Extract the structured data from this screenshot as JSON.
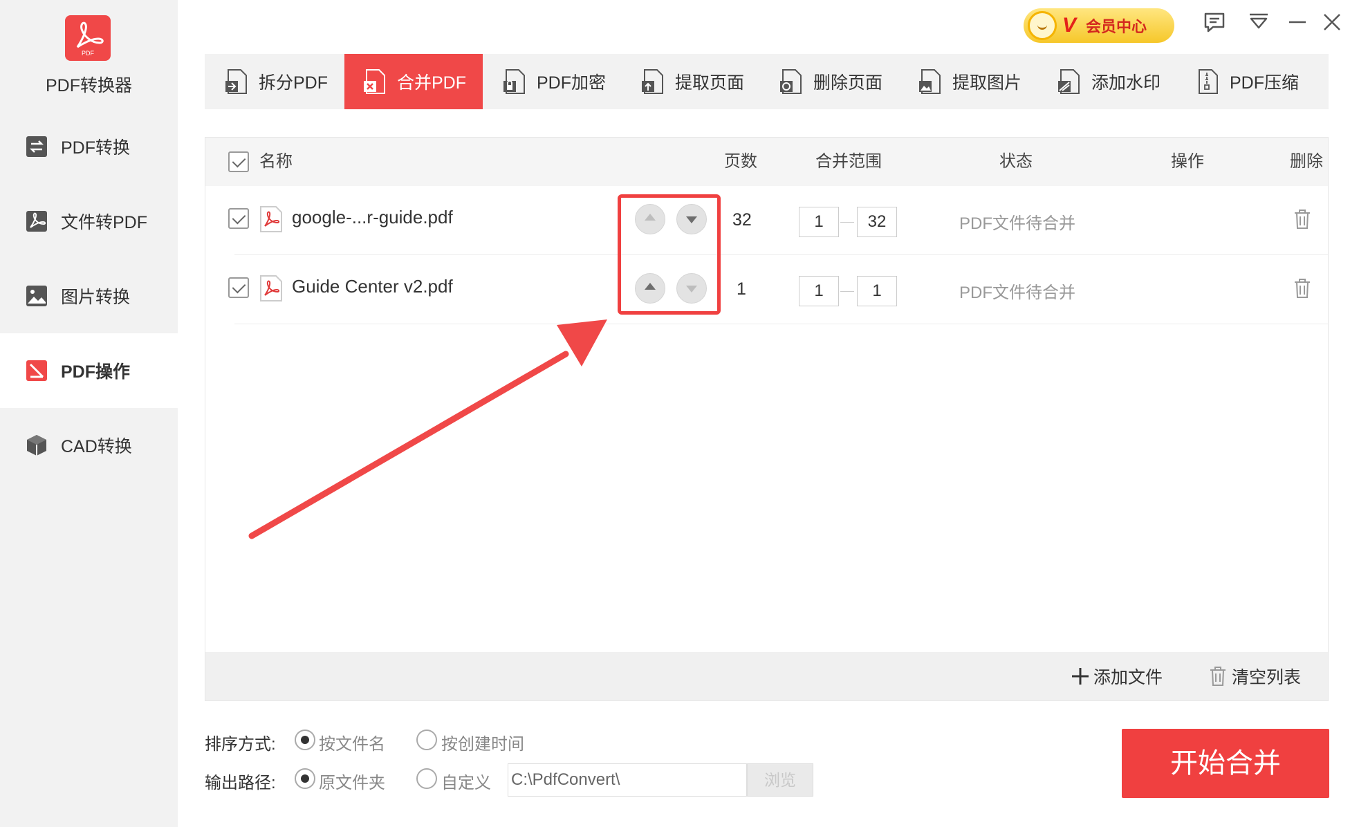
{
  "app": {
    "name": "PDF转换器"
  },
  "sidebar": {
    "items": [
      {
        "label": "PDF转换",
        "icon": "convert-icon"
      },
      {
        "label": "文件转PDF",
        "icon": "pdf-logo-icon"
      },
      {
        "label": "图片转换",
        "icon": "image-icon"
      },
      {
        "label": "PDF操作",
        "icon": "pdf-edit-icon",
        "active": true
      },
      {
        "label": "CAD转换",
        "icon": "cube-icon"
      }
    ]
  },
  "topbar": {
    "vip_label": "会员中心",
    "vip_letter": "V",
    "controls": [
      "feedback-icon",
      "menu-icon",
      "minimize-icon",
      "close-icon"
    ]
  },
  "tabs": [
    {
      "label": "拆分PDF"
    },
    {
      "label": "合并PDF",
      "active": true
    },
    {
      "label": "PDF加密"
    },
    {
      "label": "提取页面"
    },
    {
      "label": "删除页面"
    },
    {
      "label": "提取图片"
    },
    {
      "label": "添加水印"
    },
    {
      "label": "PDF压缩"
    }
  ],
  "table": {
    "headers": {
      "name": "名称",
      "pages": "页数",
      "range": "合并范围",
      "status": "状态",
      "action": "操作",
      "delete": "删除"
    },
    "rows": [
      {
        "name": "google-...r-guide.pdf",
        "pages": "32",
        "range_from": "1",
        "range_to": "32",
        "status": "PDF文件待合并"
      },
      {
        "name": "Guide Center v2.pdf",
        "pages": "1",
        "range_from": "1",
        "range_to": "1",
        "status": "PDF文件待合并"
      }
    ]
  },
  "footer": {
    "add_file": "添加文件",
    "clear_list": "清空列表"
  },
  "options": {
    "sort_label": "排序方式:",
    "sort_options": [
      "按文件名",
      "按创建时间"
    ],
    "sort_selected": "按文件名",
    "output_label": "输出路径:",
    "output_options": [
      "原文件夹",
      "自定义"
    ],
    "output_selected": "原文件夹",
    "output_path": "C:\\PdfConvert\\",
    "browse_label": "浏览"
  },
  "start_button": "开始合并",
  "colors": {
    "accent": "#f04848",
    "sidebar_bg": "#f2f2f2",
    "vip_gold": "#f6c72a"
  }
}
